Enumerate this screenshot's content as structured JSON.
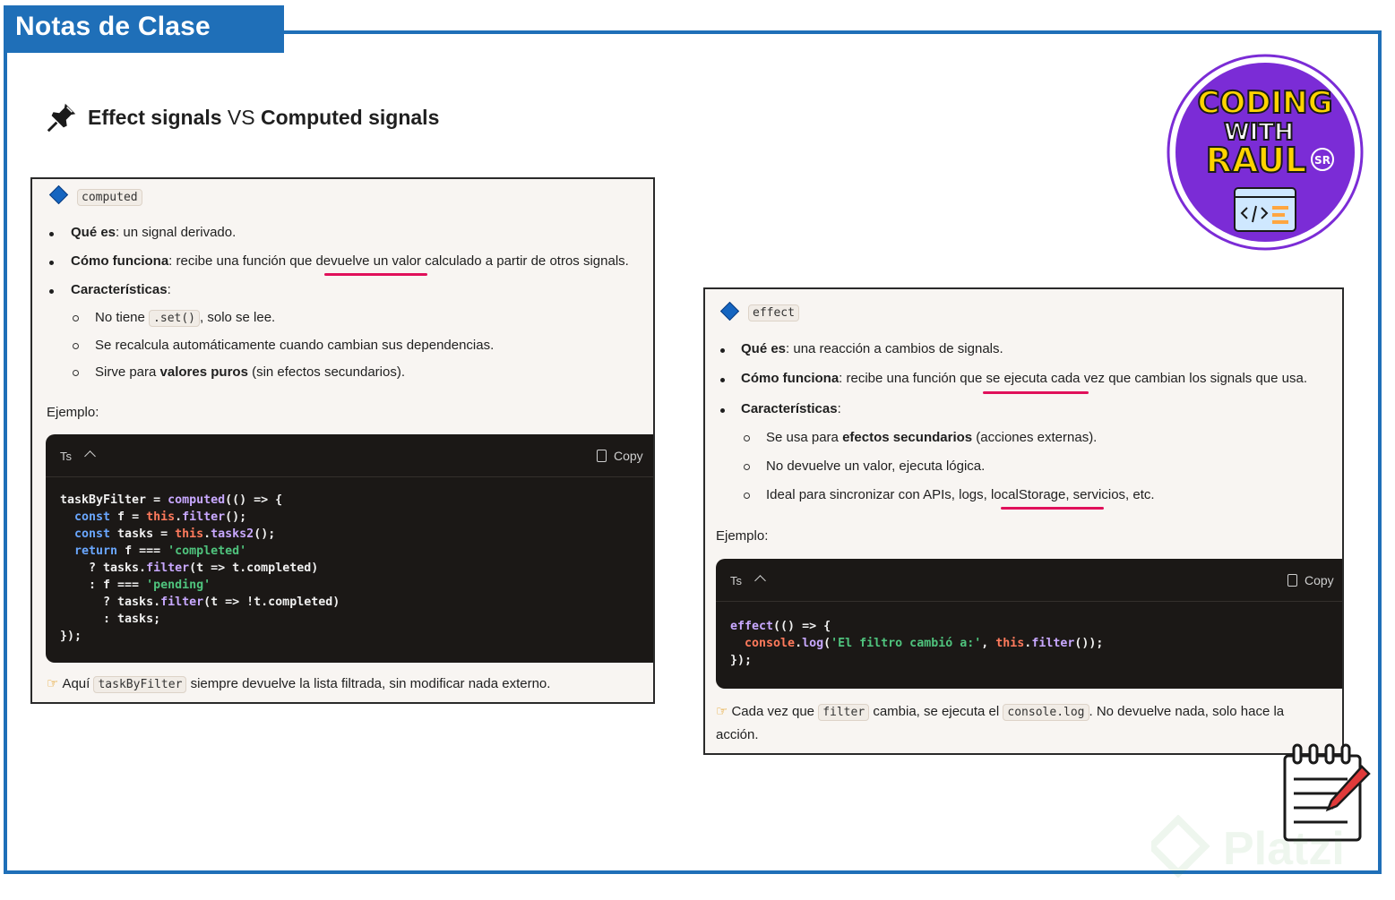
{
  "header": {
    "title": "Notas de Clase"
  },
  "heading": {
    "part1": "Effect signals",
    "vs": " VS ",
    "part2": "Computed signals"
  },
  "logo": {
    "line1": "CODING",
    "line2": "WITH",
    "line3": "RAUL",
    "badge": "SR"
  },
  "computed": {
    "tag": "computed",
    "que_label": "Qué es",
    "que_text": ": un signal derivado.",
    "como_label": "Cómo funciona",
    "como_text": ": recibe una función que devuelve un valor calculado a partir de otros signals.",
    "car_label": "Características",
    "car_colon": ":",
    "sub1_pre": "No tiene ",
    "sub1_code": ".set()",
    "sub1_post": ", solo se lee.",
    "sub2": "Se recalcula automáticamente cuando cambian sus dependencias.",
    "sub3_pre": "Sirve para ",
    "sub3_bold": "valores puros",
    "sub3_post": " (sin efectos secundarios).",
    "ejemplo": "Ejemplo:",
    "lang": "Ts",
    "copy": "Copy",
    "note_pre": "Aquí ",
    "note_code": "taskByFilter",
    "note_post": " siempre devuelve la lista filtrada, sin modificar nada externo."
  },
  "effect": {
    "tag": "effect",
    "que_label": "Qué es",
    "que_text": ": una reacción a cambios de signals.",
    "como_label": "Cómo funciona",
    "como_text": ": recibe una función que se ejecuta cada vez que cambian los signals que usa.",
    "car_label": "Características",
    "car_colon": ":",
    "sub1_pre": "Se usa para ",
    "sub1_bold": "efectos secundarios",
    "sub1_post": " (acciones externas).",
    "sub2": "No devuelve un valor, ejecuta lógica.",
    "sub3": "Ideal para sincronizar con APIs, logs, localStorage, servicios, etc.",
    "ejemplo": "Ejemplo:",
    "lang": "Ts",
    "copy": "Copy",
    "note_pre": "Cada vez que ",
    "note_code1": "filter",
    "note_mid": " cambia, se ejecuta el ",
    "note_code2": "console.log",
    "note_post": ". No devuelve nada, solo hace la",
    "note_line2": "acción."
  },
  "watermark": "Platzi"
}
